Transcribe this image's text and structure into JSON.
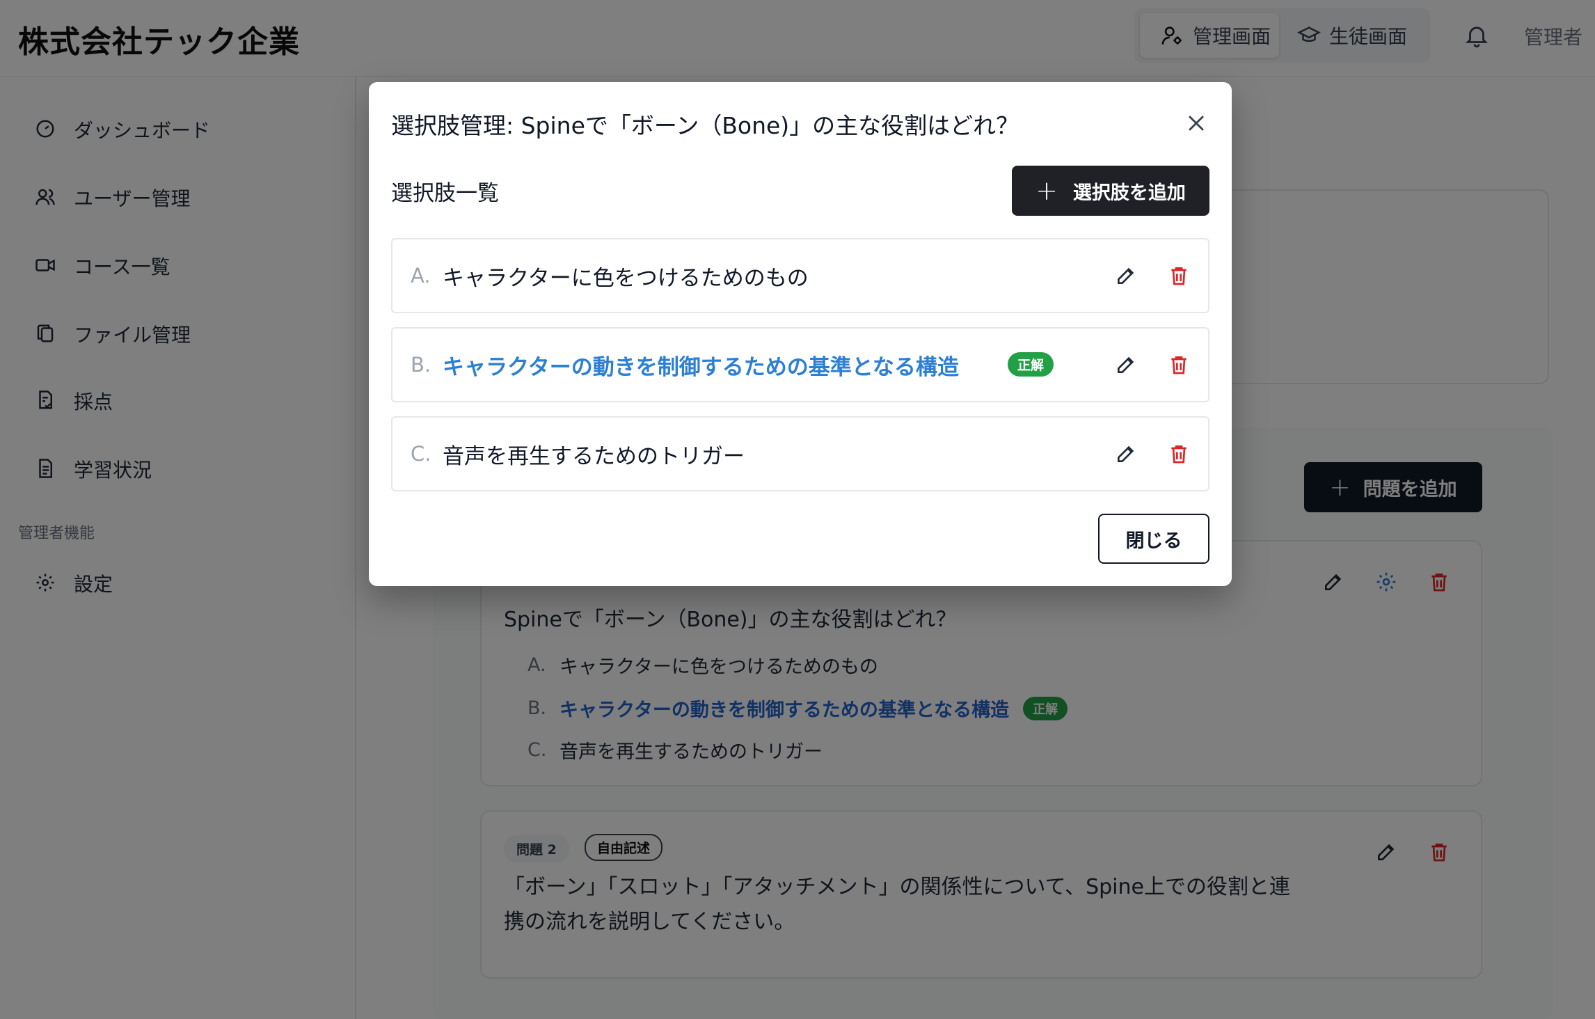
{
  "header": {
    "brand": "株式会社テック企業",
    "mode_admin": "管理画面",
    "mode_student": "生徒画面",
    "user": "管理者"
  },
  "sidebar": {
    "items": [
      {
        "label": "ダッシュボード",
        "icon": "gauge-icon"
      },
      {
        "label": "ユーザー管理",
        "icon": "users-icon"
      },
      {
        "label": "コース一覧",
        "icon": "video-icon"
      },
      {
        "label": "ファイル管理",
        "icon": "files-icon"
      },
      {
        "label": "採点",
        "icon": "grading-icon"
      },
      {
        "label": "学習状況",
        "icon": "document-icon"
      }
    ],
    "section_label": "管理者機能",
    "settings_label": "設定"
  },
  "main": {
    "add_question_label": "問題を追加",
    "questions": [
      {
        "text": "Spineで「ボーン（Bone)」の主な役割はどれ？",
        "options": [
          {
            "letter": "A.",
            "text": "キャラクターに色をつけるためのもの"
          },
          {
            "letter": "B.",
            "text": "キャラクターの動きを制御するための基準となる構造",
            "badge": "正解"
          },
          {
            "letter": "C.",
            "text": "音声を再生するためのトリガー"
          }
        ]
      },
      {
        "number_tag": "問題 2",
        "type_tag": "自由記述",
        "text_line1": "「ボーン」「スロット」「アタッチメント」の関係性について、Spine上での役割と連",
        "text_line2": "携の流れを説明してください。"
      }
    ]
  },
  "modal": {
    "title": "選択肢管理: Spineで「ボーン（Bone)」の主な役割はどれ？",
    "list_title": "選択肢一覧",
    "add_button": "選択肢を追加",
    "choices": [
      {
        "letter": "A.",
        "text": "キャラクターに色をつけるためのもの"
      },
      {
        "letter": "B.",
        "text": "キャラクターの動きを制御するための基準となる構造",
        "badge": "正解"
      },
      {
        "letter": "C.",
        "text": "音声を再生するためのトリガー"
      }
    ],
    "close_button": "閉じる"
  },
  "colors": {
    "accent_dark": "#1f2127",
    "correct_text": "#2b7fd4",
    "correct_badge": "#22a046",
    "delete_red": "#dc2626"
  }
}
